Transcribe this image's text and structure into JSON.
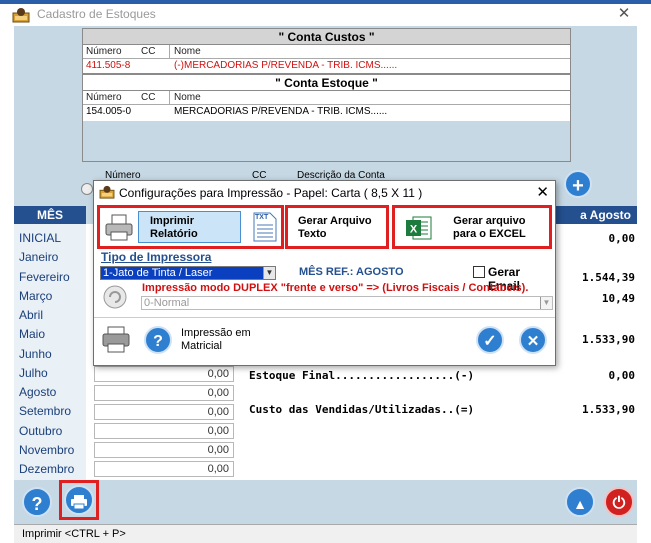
{
  "window": {
    "title": "Cadastro de Estoques",
    "close_glyph": "✕"
  },
  "conta_custos": {
    "title": "\"    Conta Custos    \"",
    "headers": [
      "Número",
      "CC",
      "Nome"
    ],
    "row": {
      "numero": "411.505-8",
      "cc": "",
      "nome": "(-)MERCADORIAS P/REVENDA - TRIB. ICMS......"
    }
  },
  "conta_estoque": {
    "title": "\"   Conta Estoque   \"",
    "headers": [
      "Número",
      "CC",
      "Nome"
    ],
    "row": {
      "numero": "154.005-0",
      "cc": "",
      "nome": "MERCADORIAS P/REVENDA - TRIB. ICMS......"
    }
  },
  "conta_labels": {
    "numero": "Número",
    "cc": "CC",
    "descricao": "Descrição da Conta"
  },
  "months": {
    "header": "MÊS",
    "items": [
      "INICIAL",
      "Janeiro",
      "Fevereiro",
      "Março",
      "Abril",
      "Maio",
      "Junho",
      "Julho",
      "Agosto",
      "Setembro",
      "Outubro",
      "Novembro",
      "Dezembro"
    ]
  },
  "right_header": "a Agosto",
  "right_values": {
    "inicial": "0,00",
    "fevereiro": "1.544,39",
    "marco": "10,49",
    "maio": "1.533,90"
  },
  "value_boxes": [
    "0,00",
    "0,00",
    "0,00",
    "0,00",
    "0,00",
    "0,00"
  ],
  "summary": {
    "estoque_final_label": "Estoque Final..................(-)",
    "estoque_final_value": "0,00",
    "custo_label": "Custo das Vendidas/Utilizadas..(=)",
    "custo_value": "1.533,90"
  },
  "dialog": {
    "title": "Configurações para Impressão - Papel: Carta ( 8,5 X 11 )",
    "close_glyph": "✕",
    "opt_print": "Imprimir\nRelatório",
    "opt_text": "Gerar Arquivo\nTexto",
    "opt_excel": "Gerar arquivo\npara o EXCEL",
    "printer_type_label": "Tipo de Impressora",
    "printer_type_value": "1-Jato de Tinta / Laser",
    "mes_ref": "MÊS REF.: AGOSTO",
    "gerar_email": "Gerar Email",
    "duplex_text": "Impressão modo DUPLEX \"frente e verso\" => (Livros Fiscais / Contábeis).",
    "duplex_value": "0-Normal",
    "matricial": "Impressão em\nMatricial",
    "txt_badge": "TXT"
  },
  "status": {
    "text": "Imprimir <CTRL + P>"
  },
  "colors": {
    "accent_blue": "#24508f",
    "panel_bg": "#c6d8e4",
    "red_outline": "#e02020",
    "red_text": "#d01010"
  }
}
